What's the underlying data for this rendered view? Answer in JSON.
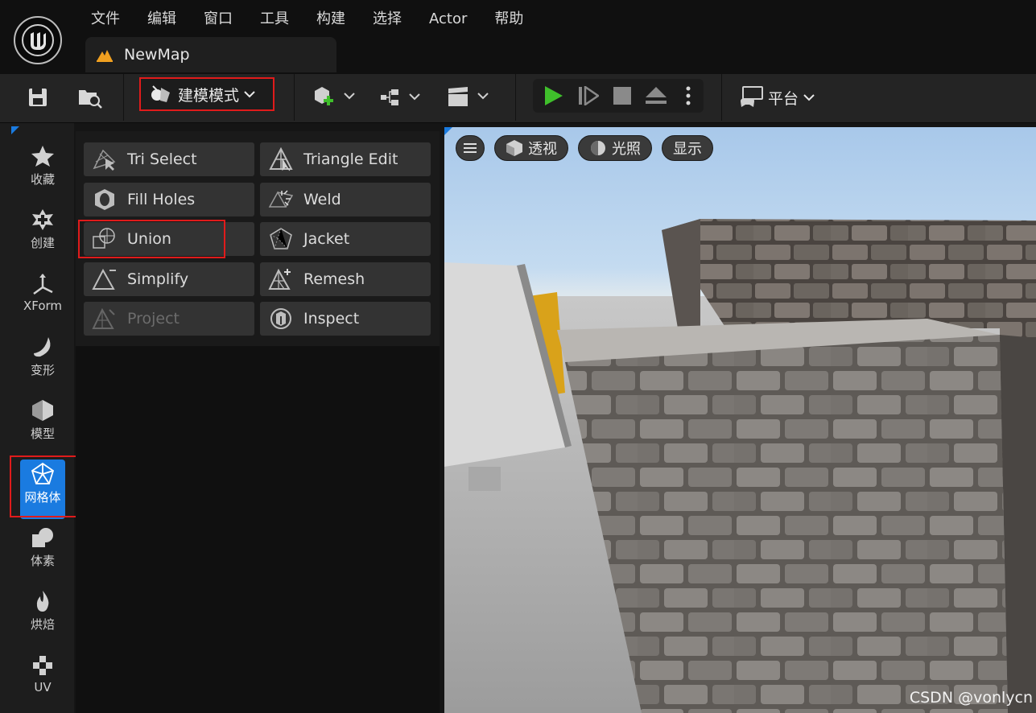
{
  "menu": [
    "文件",
    "编辑",
    "窗口",
    "工具",
    "构建",
    "选择",
    "Actor",
    "帮助"
  ],
  "tab": {
    "label": "NewMap"
  },
  "toolbar": {
    "mode_label": "建模模式",
    "platform_label": "平台"
  },
  "rail": [
    {
      "label": "收藏",
      "icon": "star-icon"
    },
    {
      "label": "创建",
      "icon": "create-icon"
    },
    {
      "label": "XForm",
      "icon": "xform-icon"
    },
    {
      "label": "变形",
      "icon": "deform-icon"
    },
    {
      "label": "模型",
      "icon": "model-icon"
    },
    {
      "label": "网格体",
      "icon": "mesh-icon",
      "active": true
    },
    {
      "label": "体素",
      "icon": "voxel-icon"
    },
    {
      "label": "烘焙",
      "icon": "bake-icon"
    },
    {
      "label": "UV",
      "icon": "uv-icon"
    }
  ],
  "tools": [
    {
      "label": "Tri Select"
    },
    {
      "label": "Triangle Edit"
    },
    {
      "label": "Fill Holes"
    },
    {
      "label": "Weld"
    },
    {
      "label": "Union"
    },
    {
      "label": "Jacket"
    },
    {
      "label": "Simplify"
    },
    {
      "label": "Remesh"
    },
    {
      "label": "Project",
      "disabled": true
    },
    {
      "label": "Inspect"
    }
  ],
  "viewport": {
    "perspective_label": "透视",
    "lighting_label": "光照",
    "show_label": "显示"
  },
  "watermark": "CSDN @vonlycn",
  "colors": {
    "accent": "#1a7be0",
    "highlight_box": "#e01b1b",
    "play_green": "#3fbf2b",
    "bg": "#151515"
  }
}
